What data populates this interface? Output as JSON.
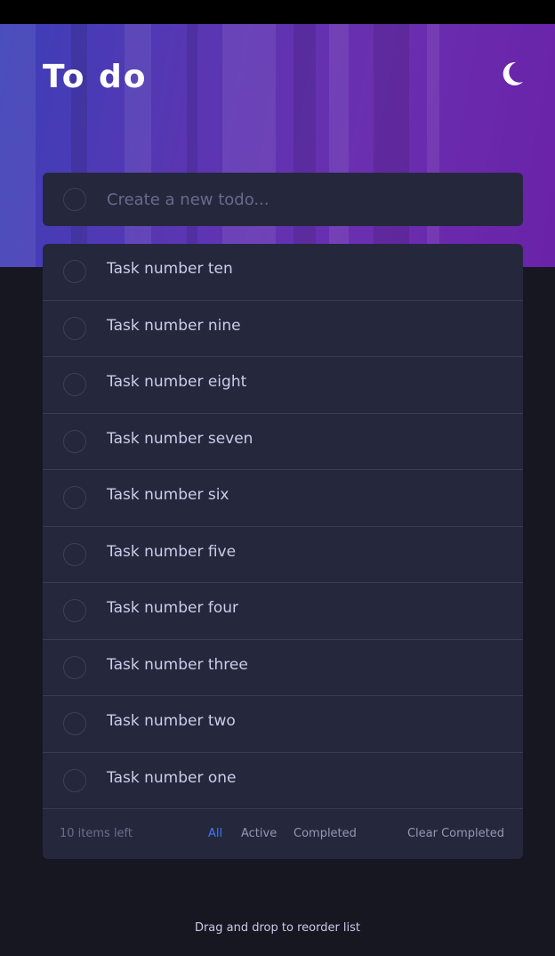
{
  "app": {
    "title": "To do"
  },
  "header": {
    "theme_icon": "moon-icon"
  },
  "new_todo": {
    "placeholder": "Create a new todo..."
  },
  "todos": [
    {
      "label": "Task number ten"
    },
    {
      "label": "Task number nine"
    },
    {
      "label": "Task number eight"
    },
    {
      "label": "Task number seven"
    },
    {
      "label": "Task number six"
    },
    {
      "label": "Task number five"
    },
    {
      "label": "Task number four"
    },
    {
      "label": "Task number three"
    },
    {
      "label": "Task number two"
    },
    {
      "label": "Task number one"
    }
  ],
  "footer": {
    "items_left": "10 items left",
    "filters": [
      "All",
      "Active",
      "Completed"
    ],
    "active_filter": "All",
    "clear_label": "Clear Completed"
  },
  "hint": "Drag and drop to reorder list",
  "colors": {
    "background": "#171722",
    "card": "#25273d",
    "active_filter": "#3a7bfd",
    "gradient_start": "#3b3fb8",
    "gradient_end": "#6a22a8"
  }
}
